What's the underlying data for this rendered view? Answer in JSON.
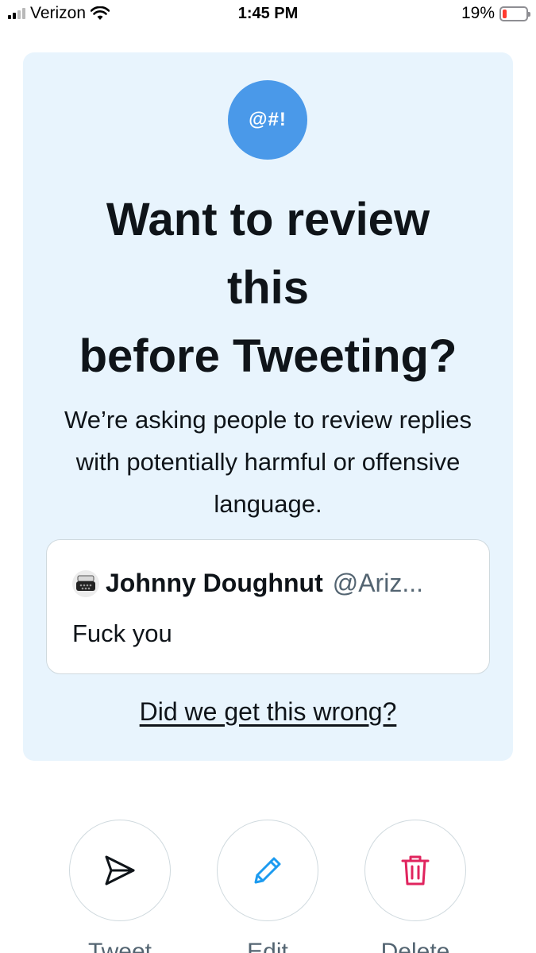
{
  "status_bar": {
    "carrier": "Verizon",
    "time": "1:45 PM",
    "battery": "19%",
    "battery_level": 0.19
  },
  "badge": {
    "text": "@#!",
    "color": "#4a99e9"
  },
  "title_lines": [
    "Want to review",
    "this",
    "before Tweeting?"
  ],
  "description": "We’re asking people to review replies with potentially harmful or offensive language.",
  "tweet": {
    "display_name": "Johnny Doughnut",
    "handle": "@Ariz...",
    "text": "Fuck you",
    "avatar_icon": "typewriter-icon"
  },
  "feedback_link": "Did we get this wrong?",
  "actions": [
    {
      "label": "Tweet",
      "icon": "send-icon",
      "color": "#0f1419"
    },
    {
      "label": "Edit",
      "icon": "pencil-icon",
      "color": "#1d9bf0"
    },
    {
      "label": "Delete",
      "icon": "trash-icon",
      "color": "#e0245e"
    }
  ],
  "colors": {
    "card_bg": "#e8f4fd",
    "accent": "#4a99e9",
    "delete": "#e0245e"
  }
}
